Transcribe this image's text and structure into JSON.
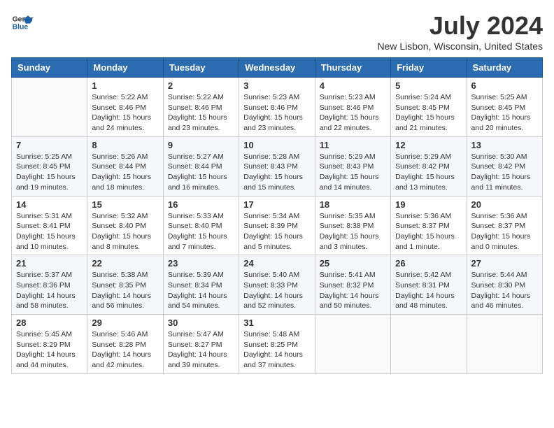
{
  "header": {
    "logo_general": "General",
    "logo_blue": "Blue",
    "month_title": "July 2024",
    "location": "New Lisbon, Wisconsin, United States"
  },
  "days_of_week": [
    "Sunday",
    "Monday",
    "Tuesday",
    "Wednesday",
    "Thursday",
    "Friday",
    "Saturday"
  ],
  "weeks": [
    [
      {
        "day": "",
        "info": ""
      },
      {
        "day": "1",
        "info": "Sunrise: 5:22 AM\nSunset: 8:46 PM\nDaylight: 15 hours\nand 24 minutes."
      },
      {
        "day": "2",
        "info": "Sunrise: 5:22 AM\nSunset: 8:46 PM\nDaylight: 15 hours\nand 23 minutes."
      },
      {
        "day": "3",
        "info": "Sunrise: 5:23 AM\nSunset: 8:46 PM\nDaylight: 15 hours\nand 23 minutes."
      },
      {
        "day": "4",
        "info": "Sunrise: 5:23 AM\nSunset: 8:46 PM\nDaylight: 15 hours\nand 22 minutes."
      },
      {
        "day": "5",
        "info": "Sunrise: 5:24 AM\nSunset: 8:45 PM\nDaylight: 15 hours\nand 21 minutes."
      },
      {
        "day": "6",
        "info": "Sunrise: 5:25 AM\nSunset: 8:45 PM\nDaylight: 15 hours\nand 20 minutes."
      }
    ],
    [
      {
        "day": "7",
        "info": "Sunrise: 5:25 AM\nSunset: 8:45 PM\nDaylight: 15 hours\nand 19 minutes."
      },
      {
        "day": "8",
        "info": "Sunrise: 5:26 AM\nSunset: 8:44 PM\nDaylight: 15 hours\nand 18 minutes."
      },
      {
        "day": "9",
        "info": "Sunrise: 5:27 AM\nSunset: 8:44 PM\nDaylight: 15 hours\nand 16 minutes."
      },
      {
        "day": "10",
        "info": "Sunrise: 5:28 AM\nSunset: 8:43 PM\nDaylight: 15 hours\nand 15 minutes."
      },
      {
        "day": "11",
        "info": "Sunrise: 5:29 AM\nSunset: 8:43 PM\nDaylight: 15 hours\nand 14 minutes."
      },
      {
        "day": "12",
        "info": "Sunrise: 5:29 AM\nSunset: 8:42 PM\nDaylight: 15 hours\nand 13 minutes."
      },
      {
        "day": "13",
        "info": "Sunrise: 5:30 AM\nSunset: 8:42 PM\nDaylight: 15 hours\nand 11 minutes."
      }
    ],
    [
      {
        "day": "14",
        "info": "Sunrise: 5:31 AM\nSunset: 8:41 PM\nDaylight: 15 hours\nand 10 minutes."
      },
      {
        "day": "15",
        "info": "Sunrise: 5:32 AM\nSunset: 8:40 PM\nDaylight: 15 hours\nand 8 minutes."
      },
      {
        "day": "16",
        "info": "Sunrise: 5:33 AM\nSunset: 8:40 PM\nDaylight: 15 hours\nand 7 minutes."
      },
      {
        "day": "17",
        "info": "Sunrise: 5:34 AM\nSunset: 8:39 PM\nDaylight: 15 hours\nand 5 minutes."
      },
      {
        "day": "18",
        "info": "Sunrise: 5:35 AM\nSunset: 8:38 PM\nDaylight: 15 hours\nand 3 minutes."
      },
      {
        "day": "19",
        "info": "Sunrise: 5:36 AM\nSunset: 8:37 PM\nDaylight: 15 hours\nand 1 minute."
      },
      {
        "day": "20",
        "info": "Sunrise: 5:36 AM\nSunset: 8:37 PM\nDaylight: 15 hours\nand 0 minutes."
      }
    ],
    [
      {
        "day": "21",
        "info": "Sunrise: 5:37 AM\nSunset: 8:36 PM\nDaylight: 14 hours\nand 58 minutes."
      },
      {
        "day": "22",
        "info": "Sunrise: 5:38 AM\nSunset: 8:35 PM\nDaylight: 14 hours\nand 56 minutes."
      },
      {
        "day": "23",
        "info": "Sunrise: 5:39 AM\nSunset: 8:34 PM\nDaylight: 14 hours\nand 54 minutes."
      },
      {
        "day": "24",
        "info": "Sunrise: 5:40 AM\nSunset: 8:33 PM\nDaylight: 14 hours\nand 52 minutes."
      },
      {
        "day": "25",
        "info": "Sunrise: 5:41 AM\nSunset: 8:32 PM\nDaylight: 14 hours\nand 50 minutes."
      },
      {
        "day": "26",
        "info": "Sunrise: 5:42 AM\nSunset: 8:31 PM\nDaylight: 14 hours\nand 48 minutes."
      },
      {
        "day": "27",
        "info": "Sunrise: 5:44 AM\nSunset: 8:30 PM\nDaylight: 14 hours\nand 46 minutes."
      }
    ],
    [
      {
        "day": "28",
        "info": "Sunrise: 5:45 AM\nSunset: 8:29 PM\nDaylight: 14 hours\nand 44 minutes."
      },
      {
        "day": "29",
        "info": "Sunrise: 5:46 AM\nSunset: 8:28 PM\nDaylight: 14 hours\nand 42 minutes."
      },
      {
        "day": "30",
        "info": "Sunrise: 5:47 AM\nSunset: 8:27 PM\nDaylight: 14 hours\nand 39 minutes."
      },
      {
        "day": "31",
        "info": "Sunrise: 5:48 AM\nSunset: 8:25 PM\nDaylight: 14 hours\nand 37 minutes."
      },
      {
        "day": "",
        "info": ""
      },
      {
        "day": "",
        "info": ""
      },
      {
        "day": "",
        "info": ""
      }
    ]
  ]
}
